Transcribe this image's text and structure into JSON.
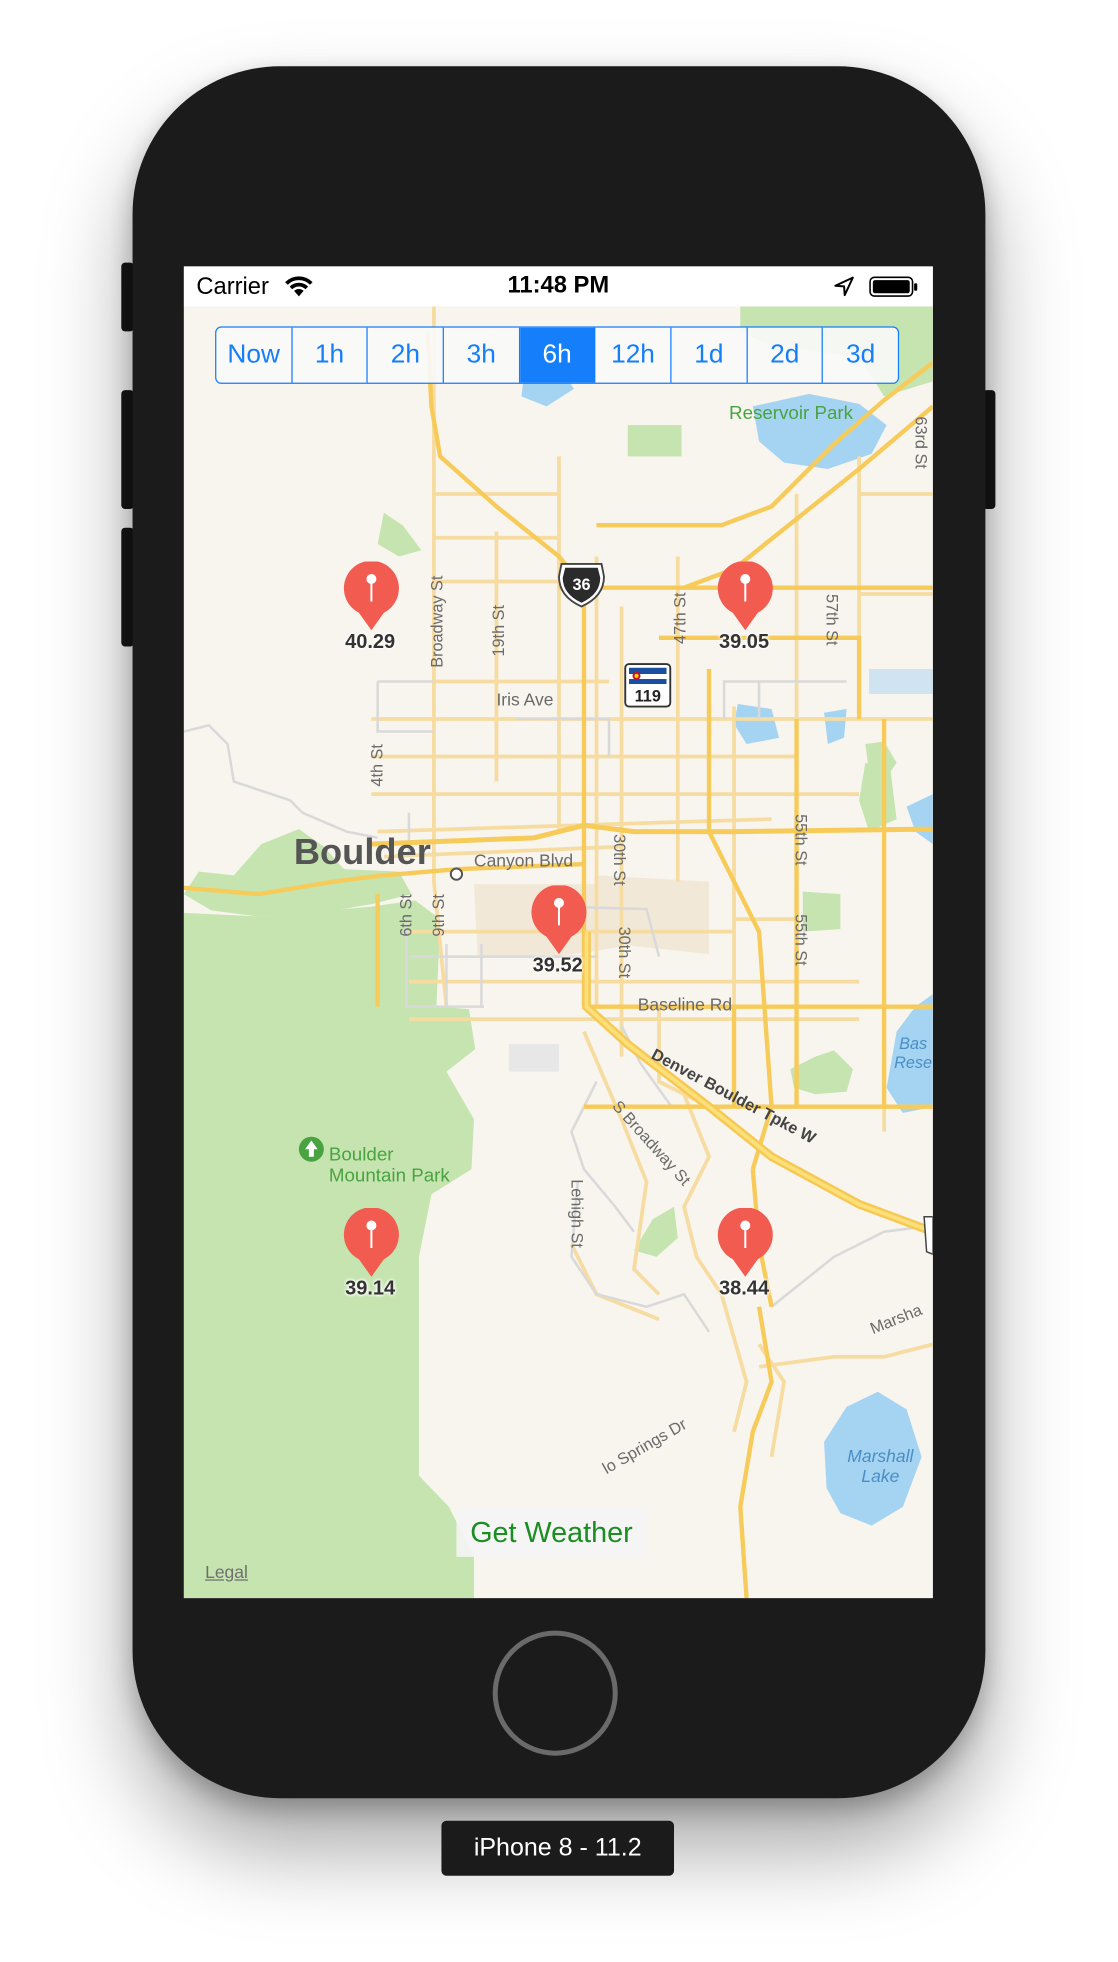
{
  "status_bar": {
    "carrier": "Carrier",
    "time": "11:48 PM",
    "icons": [
      "wifi-icon",
      "location-arrow-icon",
      "battery-icon"
    ]
  },
  "time_range": {
    "options": [
      "Now",
      "1h",
      "2h",
      "3h",
      "6h",
      "12h",
      "1d",
      "2d",
      "3d"
    ],
    "selected": "6h"
  },
  "map": {
    "city_label": "Boulder",
    "parks": {
      "reservoir": "Reservoir Park",
      "mountain_line1": "Boulder",
      "mountain_line2": "Mountain Park"
    },
    "streets": {
      "canyon": "Canyon Blvd",
      "iris": "Iris Ave",
      "baseline": "Baseline Rd",
      "denver_boulder": "Denver Boulder Tpke W",
      "s_broadway": "S Broadway St",
      "lehigh": "Lehigh St",
      "broadway": "Broadway St",
      "nineteenth": "19th St",
      "fourth": "4th St",
      "sixth": "6th St",
      "ninth": "9th St",
      "thirtieth_a": "30th St",
      "thirtieth_b": "30th St",
      "forty_seventh": "47th St",
      "fifty_seventh": "57th St",
      "fifty_fifth_a": "55th St",
      "fifty_fifth_b": "55th St",
      "sixty_third": "63rd St",
      "marshall_rd": "Marsha",
      "eldorado": "lo Springs Dr"
    },
    "water": {
      "marshall_line1": "Marshall",
      "marshall_line2": "Lake",
      "base_line1": "Bas",
      "base_line2": "Rese"
    },
    "shields": {
      "us36": "36",
      "co119": "119"
    },
    "pins": [
      {
        "value": "40.29"
      },
      {
        "value": "39.05"
      },
      {
        "value": "39.52"
      },
      {
        "value": "39.14"
      },
      {
        "value": "38.44"
      }
    ],
    "legal": "Legal"
  },
  "get_weather_button": "Get Weather",
  "device_label": "iPhone 8 - 11.2",
  "colors": {
    "accent": "#147efb",
    "pin": "#f25b50",
    "button_text": "#1b8d22",
    "park": "#c5e4b0",
    "water": "#a5d4f2",
    "road_major": "#f7cb5a",
    "road_minor": "#f6dca0"
  }
}
